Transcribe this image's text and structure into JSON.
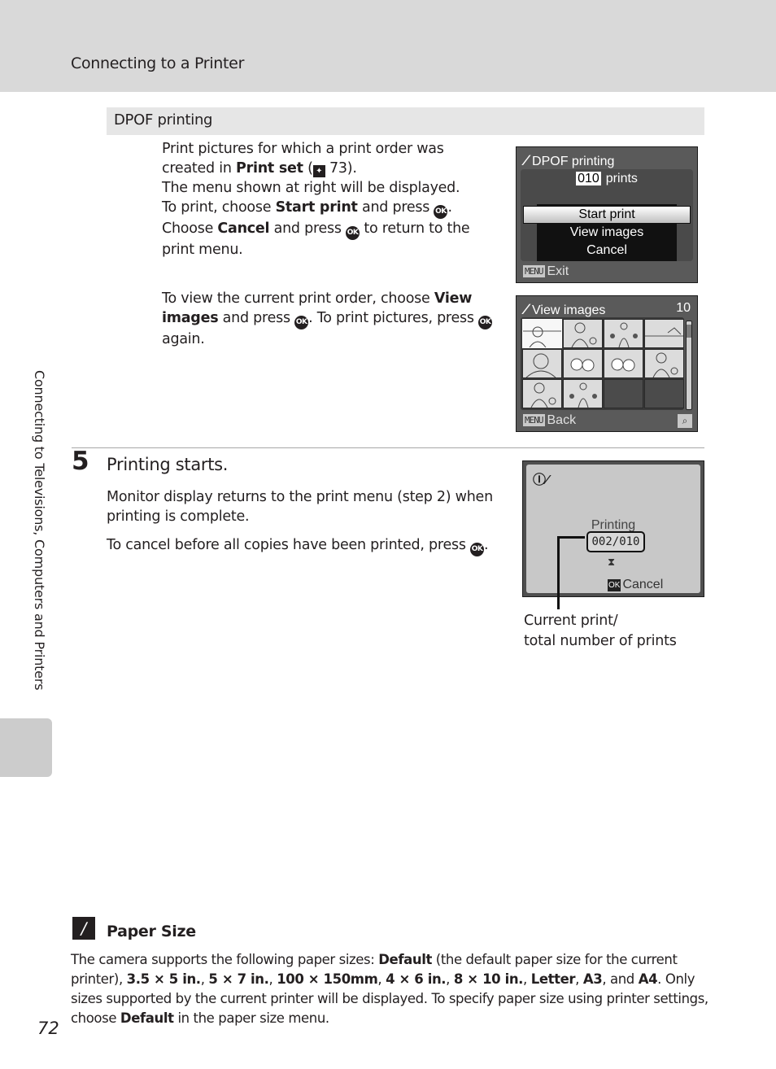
{
  "header": {
    "title": "Connecting to a Printer"
  },
  "section": {
    "title": "DPOF printing"
  },
  "intro": {
    "p1_a": "Print pictures for which a print order was created in ",
    "p1_bold": "Print set",
    "p1_ref_open": " (",
    "p1_ref_icon": "✦",
    "p1_ref_page": " 73).",
    "p2": "The menu shown at right will be displayed.",
    "p3_a": "To print, choose ",
    "p3_bold": "Start print",
    "p3_b": " and press ",
    "p3_c": ".",
    "p4_a": "Choose ",
    "p4_bold": "Cancel",
    "p4_b": " and press ",
    "p4_c": " to return to the print menu.",
    "ok": "OK"
  },
  "view_para": {
    "a": "To view the current print order, choose ",
    "bold": "View images",
    "b": " and press ",
    "c": ". To print pictures, press ",
    "d": " again."
  },
  "screen_dpof": {
    "title": "DPOF printing",
    "count": "010",
    "prints_label": "prints",
    "menu": [
      "Start print",
      "View images",
      "Cancel"
    ],
    "selected_index": 0,
    "footer_key": "MENU",
    "footer_label": "Exit"
  },
  "screen_view": {
    "title": "View images",
    "count": "10",
    "footer_key": "MENU",
    "footer_label": "Back",
    "thumbnails": [
      "woman-landscape",
      "woman-child",
      "family",
      "landscape",
      "woman-portrait",
      "flowers",
      "flowers",
      "woman-child",
      "woman-child",
      "family",
      "empty",
      "empty"
    ],
    "selected_index": 0
  },
  "step5": {
    "number": "5",
    "title": "Printing starts.",
    "p1": "Monitor display returns to the print menu (step 2) when printing is complete.",
    "p2_a": "To cancel before all copies have been printed, press ",
    "p2_b": "."
  },
  "screen_printing": {
    "icons": "Ⓘ∕",
    "label": "Printing",
    "counter": "002/010",
    "hourglass": "⧗",
    "ok_key": "OK",
    "cancel_label": "Cancel"
  },
  "callout": {
    "line1": "Current print/",
    "line2": "total number of prints"
  },
  "side_tab": {
    "label": "Connecting to Televisions, Computers and Printers"
  },
  "note": {
    "title": "Paper Size",
    "icon": "pencil-icon",
    "t1": "The camera supports the following paper sizes: ",
    "b1": "Default",
    "t2": " (the default paper size for the current printer), ",
    "sizes": [
      "3.5 × 5 in.",
      "5 × 7 in.",
      "100 × 150mm",
      "4 × 6 in.",
      "8 × 10 in.",
      "Letter",
      "A3",
      "A4"
    ],
    "t3": ". Only sizes supported by the current printer will be displayed. To specify paper size using printer settings, choose ",
    "b2": "Default",
    "t4": " in the paper size menu."
  },
  "page_number": "72"
}
